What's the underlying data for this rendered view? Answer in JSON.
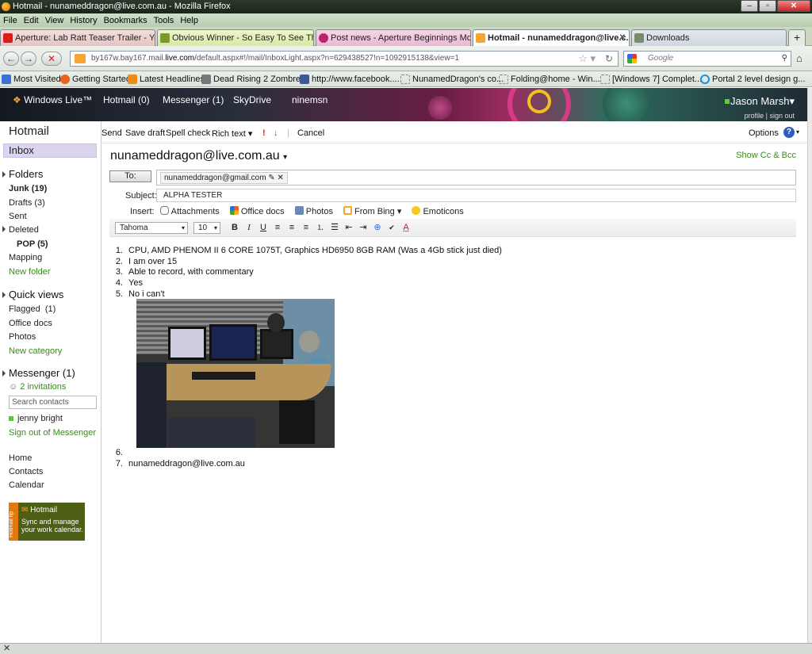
{
  "window": {
    "title": "Hotmail - nunameddragon@live.com.au - Mozilla Firefox",
    "min": "‒",
    "max": "▫",
    "close": "✕"
  },
  "menu": [
    "File",
    "Edit",
    "View",
    "History",
    "Bookmarks",
    "Tools",
    "Help"
  ],
  "tabs": [
    {
      "label": "Aperture: Lab Ratt Teaser Trailer - Yo...",
      "active": false,
      "color": "#dc1c1c"
    },
    {
      "label": "Obvious Winner - So Easy To See Th...",
      "active": false,
      "color": "#7a9a2a"
    },
    {
      "label": "Post news - Aperture Beginnings Mo...",
      "active": false,
      "color": "#c0216b"
    },
    {
      "label": "Hotmail - nunameddragon@live.c...",
      "active": true,
      "color": "#f7a531"
    },
    {
      "label": "Downloads",
      "active": false,
      "color": "#7a8a6a"
    }
  ],
  "url": {
    "prefix": "by167w.bay167.mail.",
    "domain": "live.com",
    "suffix": "/default.aspx#!/mail/InboxLight.aspx?n=629438527!n=1092915138&view=1"
  },
  "search_placeholder": "Google",
  "bookmarks": [
    {
      "label": "Most Visited",
      "icon": "most-visited-icon"
    },
    {
      "label": "Getting Started",
      "icon": "firefox-icon"
    },
    {
      "label": "Latest Headlines",
      "icon": "rss-icon"
    },
    {
      "label": "Dead Rising 2 Zombre...",
      "icon": "site-icon"
    },
    {
      "label": "http://www.facebook....",
      "icon": "facebook-icon"
    },
    {
      "label": "NunamedDragon's co...",
      "icon": "page-icon"
    },
    {
      "label": "Folding@home - Win...",
      "icon": "page-icon"
    },
    {
      "label": "[Windows 7] Complet...",
      "icon": "page-icon"
    },
    {
      "label": "Portal 2 level design g...",
      "icon": "portal-icon"
    }
  ],
  "header": {
    "brand": "Windows Live™",
    "nav": [
      "Hotmail (0)",
      "Messenger (1)",
      "SkyDrive",
      "ninemsn"
    ],
    "user": "Jason Marsh",
    "profile": "profile",
    "signout": "sign out",
    "divider": "|"
  },
  "sidebar": {
    "title": "Hotmail",
    "inbox": "Inbox",
    "folders_header": "Folders",
    "junk": "Junk (19)",
    "drafts": "Drafts (3)",
    "sent": "Sent",
    "deleted": "Deleted",
    "pop": "POP (5)",
    "mapping": "Mapping",
    "new_folder": "New folder",
    "quick_views": "Quick views",
    "flagged": "Flagged",
    "flagged_count": "(1)",
    "office_docs": "Office docs",
    "photos": "Photos",
    "new_category": "New category",
    "messenger": "Messenger (1)",
    "invitations": "2 invitations",
    "search_contacts": "Search contacts",
    "contact": "jenny bright",
    "sign_out_messenger": "Sign out of Messenger",
    "home": "Home",
    "contacts": "Contacts",
    "calendar": "Calendar",
    "ad_title": "Hotmail",
    "ad_text": "Sync and manage your work calendar.",
    "ad_tip": "Hotmail tip"
  },
  "toolbar": {
    "send": "Send",
    "save_draft": "Save draft",
    "spell_check": "Spell check",
    "rich_text": "Rich text",
    "cancel": "Cancel",
    "options": "Options"
  },
  "compose": {
    "from": "nunameddragon@live.com.au",
    "show_cc": "Show Cc & Bcc",
    "to_label": "To:",
    "to_value": "nunameddragon@gmail.com",
    "subject_label": "Subject:",
    "subject": "ALPHA TESTER",
    "insert_label": "Insert:",
    "insert": [
      "Attachments",
      "Office docs",
      "Photos",
      "From Bing",
      "Emoticons"
    ],
    "font": "Tahoma",
    "size": "10",
    "fmt": {
      "bold": "B",
      "italic": "I",
      "underline": "U",
      "font_color": "A"
    }
  },
  "body": {
    "n1": "1.",
    "l1": "CPU, AMD PHENOM II 6 CORE 1075T, Graphics HD6950 8GB RAM (Was a 4Gb stick just died)",
    "n2": "2.",
    "l2": "I am over 15",
    "n3": "3.",
    "l3": "Able to record, with commentary",
    "n4": "4.",
    "l4": "Yes",
    "n5": "5.",
    "l5": "No i can't",
    "n6": "6.",
    "n7": "7.",
    "l7": "nunameddragon@live.com.au"
  },
  "status": "✕"
}
